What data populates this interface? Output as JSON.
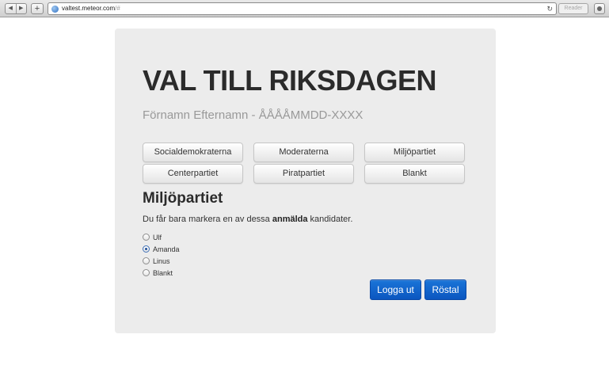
{
  "browser": {
    "back_glyph": "◀",
    "forward_glyph": "▶",
    "new_tab_glyph": "+",
    "url_host": "valtest.meteor.com",
    "url_hash": "/#",
    "reload_glyph": "↻",
    "reader_label": "Reader"
  },
  "page": {
    "title": "VAL TILL RIKSDAGEN",
    "voter": "Förnamn Efternamn - ÅÅÅÅMMDD-XXXX",
    "parties": [
      "Socialdemokraterna",
      "Moderaterna",
      "Miljöpartiet",
      "Centerpartiet",
      "Piratpartiet",
      "Blankt"
    ],
    "selected_party": "Miljöpartiet",
    "instruction_before": "Du får bara markera en av dessa ",
    "instruction_bold": "anmälda",
    "instruction_after": " kandidater.",
    "candidates": [
      {
        "name": "Ulf",
        "checked": false
      },
      {
        "name": "Amanda",
        "checked": true
      },
      {
        "name": "Linus",
        "checked": false
      },
      {
        "name": "Blankt",
        "checked": false
      }
    ],
    "logout_label": "Logga ut",
    "vote_label": "Röstal"
  },
  "colors": {
    "panel_bg": "#ececec",
    "primary": "#0b56c0",
    "subtitle": "#999999"
  }
}
